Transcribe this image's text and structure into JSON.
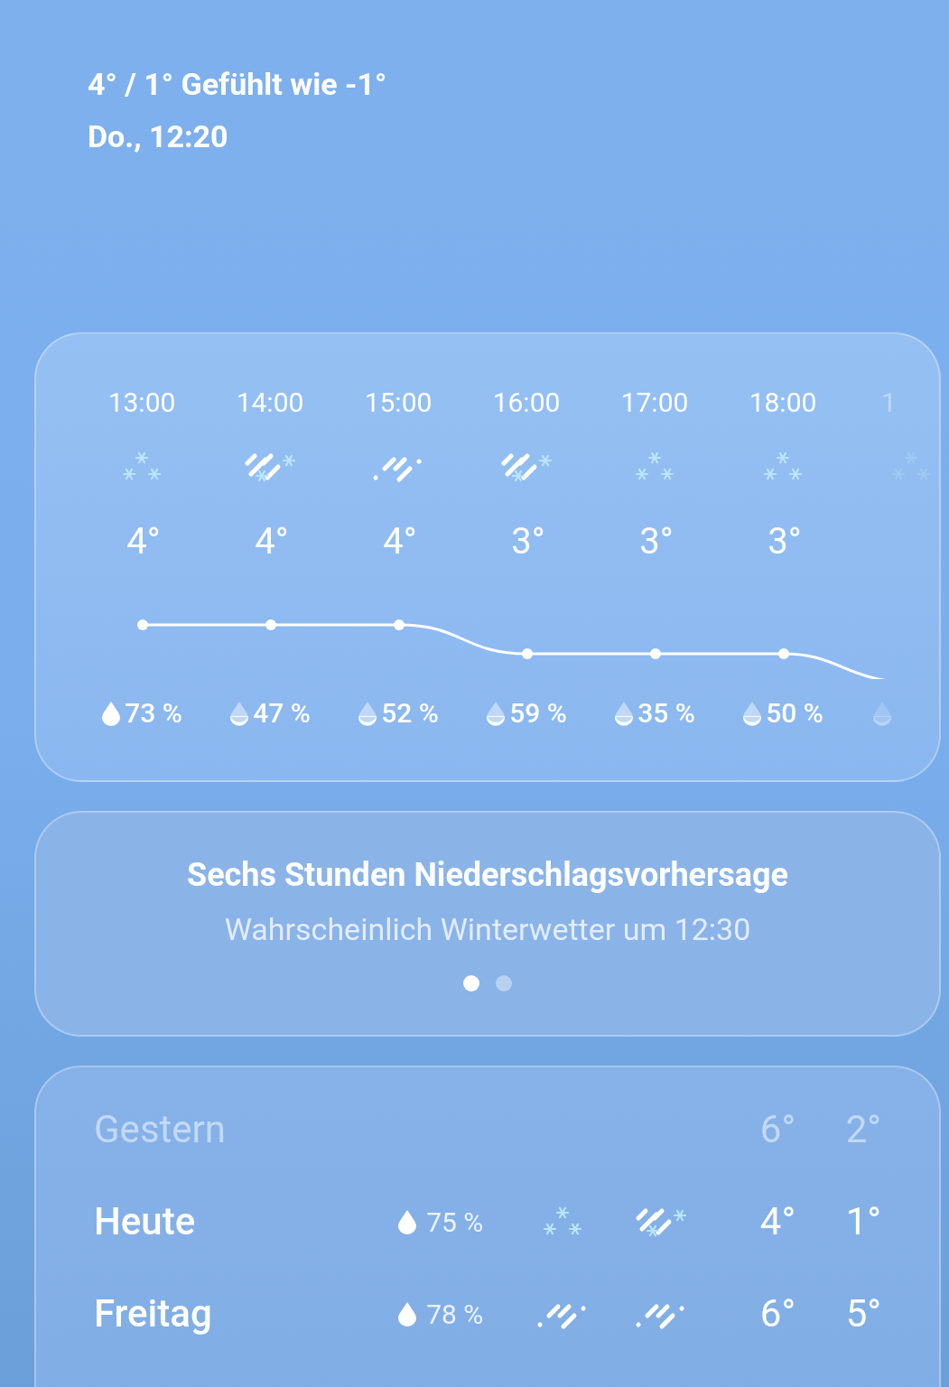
{
  "current": {
    "temps": "4° / 1° Gefühlt wie -1°",
    "datetime": "Do., 12:20"
  },
  "hourly": [
    {
      "time": "13:00",
      "kind": "snow",
      "temp": "4°",
      "drop_full": true,
      "precip": "73 %"
    },
    {
      "time": "14:00",
      "kind": "sleet",
      "temp": "4°",
      "drop_full": false,
      "precip": "47 %"
    },
    {
      "time": "15:00",
      "kind": "rain",
      "temp": "4°",
      "drop_full": false,
      "precip": "52 %"
    },
    {
      "time": "16:00",
      "kind": "sleet",
      "temp": "3°",
      "drop_full": false,
      "precip": "59 %"
    },
    {
      "time": "17:00",
      "kind": "snow",
      "temp": "3°",
      "drop_full": false,
      "precip": "35 %"
    },
    {
      "time": "18:00",
      "kind": "snow",
      "temp": "3°",
      "drop_full": false,
      "precip": "50 %"
    },
    {
      "time": "1",
      "kind": "snow",
      "drop_full": false
    }
  ],
  "forecast_card": {
    "title": "Sechs Stunden Niederschlagsvorhersage",
    "subtitle": "Wahrscheinlich Winterwetter um 12:30",
    "pages": [
      {
        "selected": true
      },
      {
        "selected": false
      }
    ]
  },
  "daily": [
    {
      "day": "Gestern",
      "past": true,
      "high": "6°",
      "low": "2°"
    },
    {
      "day": "Heute",
      "past": false,
      "precip": "75 %",
      "icons": [
        {
          "kind": "snow"
        },
        {
          "kind": "sleet"
        }
      ],
      "high": "4°",
      "low": "1°"
    },
    {
      "day": "Freitag",
      "past": false,
      "precip": "78 %",
      "icons": [
        {
          "kind": "rain"
        },
        {
          "kind": "rain"
        }
      ],
      "high": "6°",
      "low": "5°"
    }
  ]
}
